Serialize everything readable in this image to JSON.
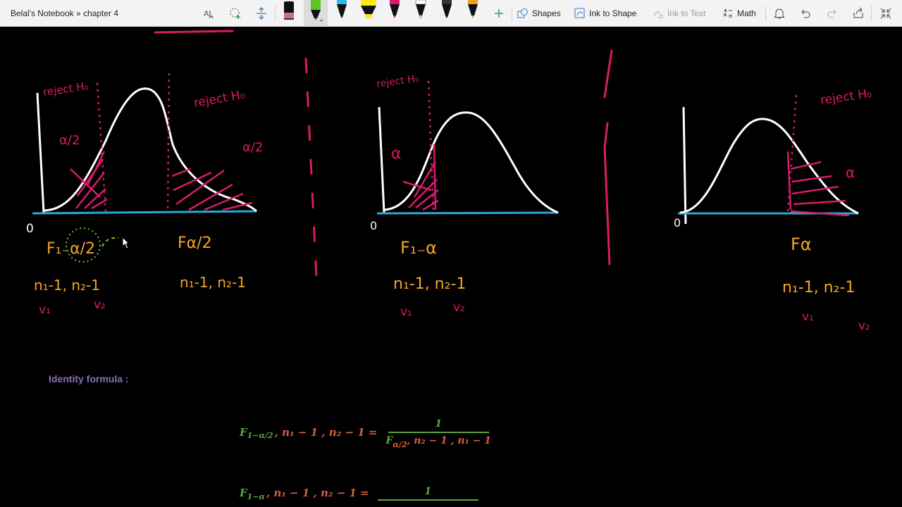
{
  "notebook": {
    "breadcrumb": "Belal's Notebook » chapter 4"
  },
  "toolbar": {
    "shapes_label": "Shapes",
    "ink_to_shape_label": "Ink to Shape",
    "ink_to_text_label": "Ink to Text",
    "math_label": "Math",
    "pens": [
      {
        "name": "black-pen",
        "color": "#111111"
      },
      {
        "name": "green-pen",
        "color": "#5cc520"
      },
      {
        "name": "cyan-pen",
        "color": "#2db6e8"
      },
      {
        "name": "yellow-highlighter",
        "color": "#ffe818"
      },
      {
        "name": "pink-pen",
        "color": "#d81b6a"
      },
      {
        "name": "white-pen",
        "color": "#ffffff"
      },
      {
        "name": "black-pen-2",
        "color": "#111111"
      },
      {
        "name": "orange-pen",
        "color": "#f0a020"
      }
    ]
  },
  "ink_colors": {
    "curve": "#ffffff",
    "axis": "#29a8d8",
    "reject": "#d81b6a",
    "labels": "#f5a623",
    "annotation": "#6ac92e"
  },
  "handwriting": {
    "graph1": {
      "reject_left": "reject H₀",
      "reject_right": "reject H₀",
      "alpha_half_left": "α/2",
      "alpha_half_right": "α/2",
      "origin": "0",
      "crit_left": "F₁₋α/2",
      "crit_right": "Fα/2",
      "df_left": "n₁-1, n₂-1",
      "df_right": "n₁-1, n₂-1",
      "v1": "v₁",
      "v2": "v₂"
    },
    "graph2": {
      "reject": "reject H₀",
      "alpha": "α",
      "origin": "0",
      "crit": "F₁₋α",
      "df": "n₁-1, n₂-1",
      "v1": "v₁",
      "v2": "v₂"
    },
    "graph3": {
      "reject": "reject H₀",
      "alpha": "α",
      "origin": "0",
      "crit": "Fα",
      "df": "n₁-1, n₂-1",
      "v1": "v₁",
      "v2": "v₂"
    }
  },
  "content": {
    "identity_title": "Identity formula :",
    "formula1": {
      "lhs_F": "F",
      "lhs_sub": "1−α/2",
      "lhs_df": ", n₁ − 1 , n₂ − 1 =",
      "numerator": "1",
      "den_F": "F",
      "den_sub": "α/2",
      "den_df": ", n₂ − 1 , n₁ − 1"
    },
    "formula2": {
      "lhs_F": "F",
      "lhs_sub": "1−α",
      "lhs_df": ", n₁ − 1 , n₂ − 1 =",
      "numerator": "1"
    }
  }
}
